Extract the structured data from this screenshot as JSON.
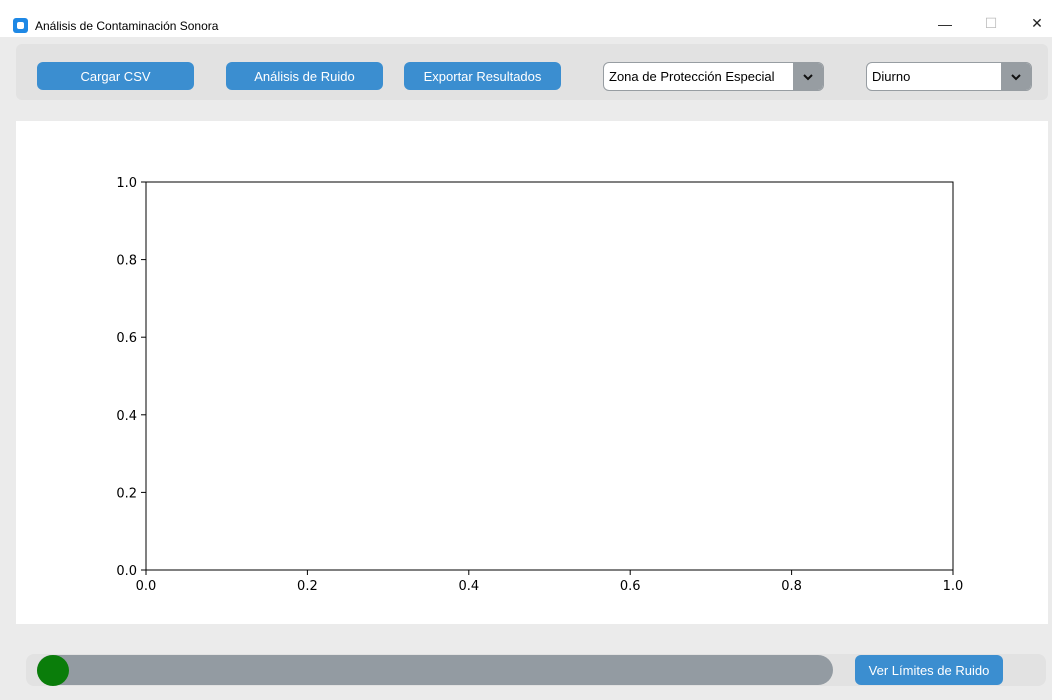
{
  "window": {
    "title": "Análisis de Contaminación Sonora",
    "minimize_glyph": "—",
    "maximize_glyph": "☐",
    "close_glyph": "✕"
  },
  "toolbar": {
    "load_csv_label": "Cargar CSV",
    "noise_analysis_label": "Análisis de Ruido",
    "export_label": "Exportar Resultados",
    "zone_select": {
      "value": "Zona de Protección Especial"
    },
    "period_select": {
      "value": "Diurno"
    }
  },
  "chart_data": {
    "type": "line",
    "title": "",
    "xlabel": "",
    "ylabel": "",
    "xlim": [
      0.0,
      1.0
    ],
    "ylim": [
      0.0,
      1.0
    ],
    "xticks": [
      "0.0",
      "0.2",
      "0.4",
      "0.6",
      "0.8",
      "1.0"
    ],
    "yticks": [
      "0.0",
      "0.2",
      "0.4",
      "0.6",
      "0.8",
      "1.0"
    ],
    "series": [],
    "grid": false
  },
  "bottom": {
    "slider_fraction": 0.0,
    "slider_knob_color": "#0a7d0a",
    "limits_button_label": "Ver Límites de Ruido"
  },
  "colors": {
    "accent": "#3b8ed0",
    "combo_arrow": "#979da2"
  }
}
